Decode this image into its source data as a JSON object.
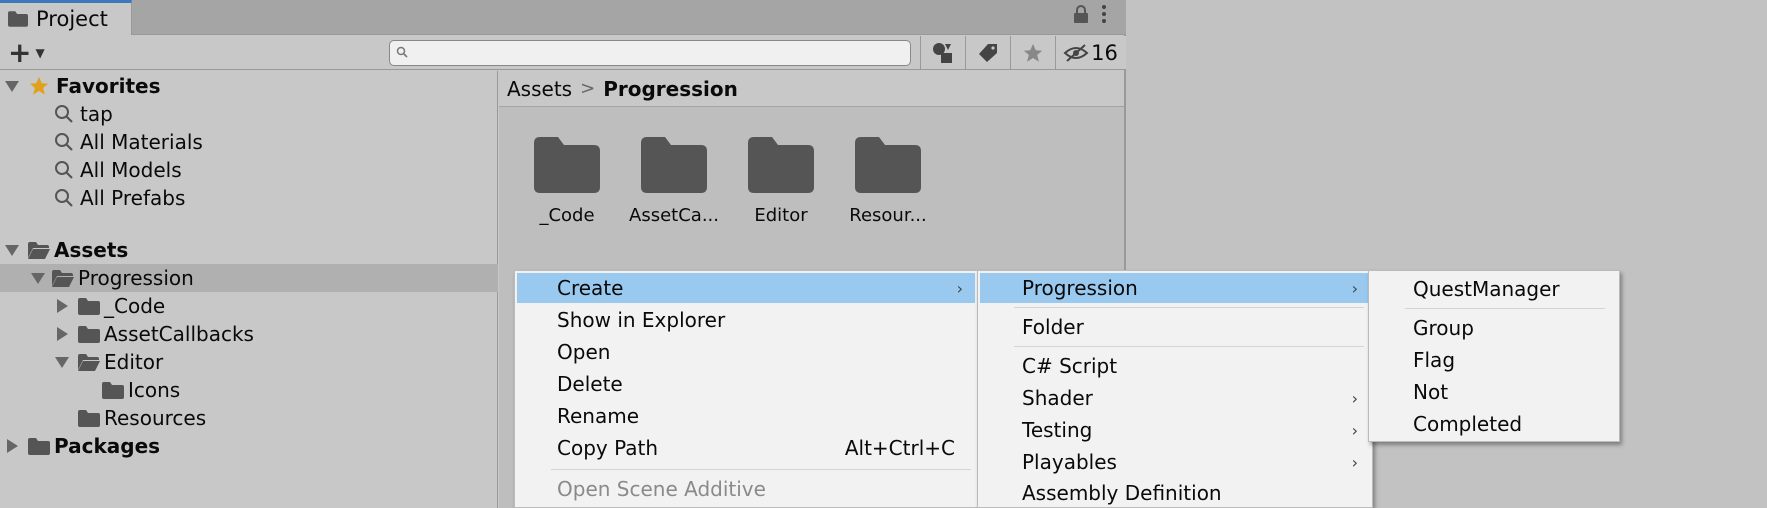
{
  "window": {
    "tab_label": "Project",
    "hidden_count": "16"
  },
  "favorites": {
    "label": "Favorites",
    "items": [
      "tap",
      "All Materials",
      "All Models",
      "All Prefabs"
    ]
  },
  "tree": {
    "assets": "Assets",
    "progression": "Progression",
    "code": "_Code",
    "asset_callbacks": "AssetCallbacks",
    "editor": "Editor",
    "icons": "Icons",
    "resources": "Resources",
    "packages": "Packages"
  },
  "breadcrumb": {
    "root": "Assets",
    "current": "Progression"
  },
  "grid": {
    "items": [
      "_Code",
      "AssetCa...",
      "Editor",
      "Resour..."
    ]
  },
  "context_menu": {
    "items": [
      "Create",
      "Show in Explorer",
      "Open",
      "Delete",
      "Rename",
      "Copy Path",
      "Open Scene Additive"
    ],
    "copy_path_shortcut": "Alt+Ctrl+C"
  },
  "create_menu": {
    "items": [
      "Progression",
      "Folder",
      "C# Script",
      "Shader",
      "Testing",
      "Playables",
      "Assembly Definition"
    ]
  },
  "progression_menu": {
    "items": [
      "QuestManager",
      "Group",
      "Flag",
      "Not",
      "Completed"
    ]
  },
  "colors": {
    "highlight": "#99c9ef",
    "tab_accent": "#3a79bb",
    "favorites_star": "#e0a21b",
    "folder": "#555555"
  }
}
